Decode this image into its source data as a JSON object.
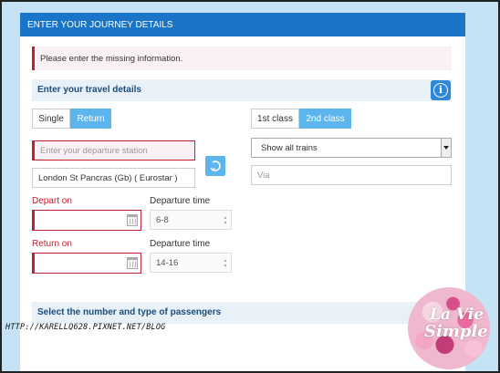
{
  "header": {
    "title": "ENTER YOUR JOURNEY DETAILS"
  },
  "alert": {
    "message": "Please enter the missing information."
  },
  "travel_section": {
    "title": "Enter your travel details",
    "info_icon": "info-icon"
  },
  "trip_type": {
    "single_label": "Single",
    "return_label": "Return",
    "selected": "Return"
  },
  "class_type": {
    "first_label": "1st class",
    "second_label": "2nd class",
    "selected": "2nd class"
  },
  "departure_station": {
    "placeholder": "Enter your departure station",
    "value": ""
  },
  "arrival_station": {
    "value": "London St Pancras  (Gb) ( Eurostar )"
  },
  "swap_icon": "swap-icon",
  "trains_filter": {
    "selected": "Show all trains"
  },
  "via": {
    "placeholder": "Via",
    "value": ""
  },
  "depart": {
    "date_label": "Depart on",
    "time_label": "Departure time",
    "date_value": "",
    "time_value": "6-8"
  },
  "return": {
    "date_label": "Return on",
    "time_label": "Departure time",
    "date_value": "",
    "time_value": "14-16"
  },
  "passengers_section": {
    "title": "Select the number and type of passengers"
  },
  "watermark": {
    "blog_url": "HTTP://KARELLQ628.PIXNET.NET/BLOG",
    "logo_line1": "La Vie",
    "logo_line2": "Simple"
  },
  "colors": {
    "header": "#1a74c7",
    "accent": "#5db5ee",
    "error": "#c0202e",
    "section_bg": "#e9f1f8",
    "outer_bg": "#c5e3f5"
  }
}
